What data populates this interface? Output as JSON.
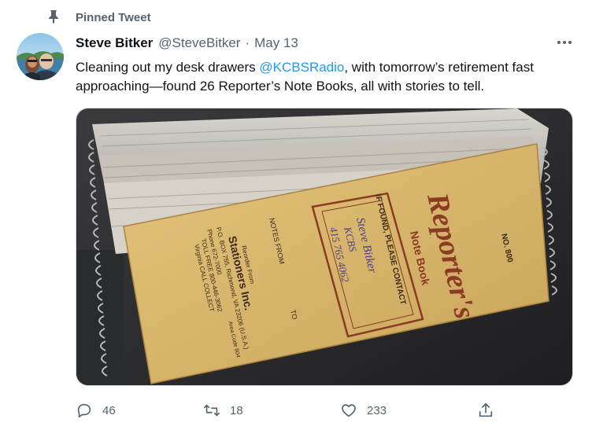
{
  "pinned": {
    "label": "Pinned Tweet"
  },
  "author": {
    "name": "Steve Bitker",
    "handle": "@SteveBitker",
    "separator": "·",
    "date": "May 13"
  },
  "tweet": {
    "text_before": "Cleaning out my desk drawers ",
    "mention": "@KCBSRadio",
    "text_after": ", with tomorrow’s retirement fast approaching—found 26 Reporter’s Note Books, all with stories to tell."
  },
  "notebook": {
    "brand": "Reporter's",
    "subtitle": "Note Book",
    "number": "NO. 800",
    "contact_label": "IF FOUND, PLEASE CONTACT",
    "contact_name": "Steve Bitker",
    "contact_org": "KCBS",
    "contact_phone": "415 765 4062",
    "notes_from": "NOTES FROM",
    "to": "TO",
    "reorder_from": "Reorder From",
    "company": "Stationers Inc.",
    "address": "P.O. BOX 755, Richmond, VA 23206 (U.S.A.)",
    "phone": "Phone 672-7000",
    "toll_free": "TOLL FREE 800-446-3062",
    "virginia": "Virginia CALL COLLECT",
    "area_code": "Area Code 804"
  },
  "actions": {
    "reply_count": "46",
    "retweet_count": "18",
    "like_count": "233"
  },
  "colors": {
    "accent": "#1d9bf0",
    "secondary_text": "#536471",
    "notebook_yellow": "#d9b76a",
    "notebook_ink": "#8a3b22"
  },
  "icons": {
    "pin": "pin-icon",
    "more": "more-icon",
    "reply": "reply-icon",
    "retweet": "retweet-icon",
    "like": "heart-icon",
    "share": "share-icon"
  }
}
